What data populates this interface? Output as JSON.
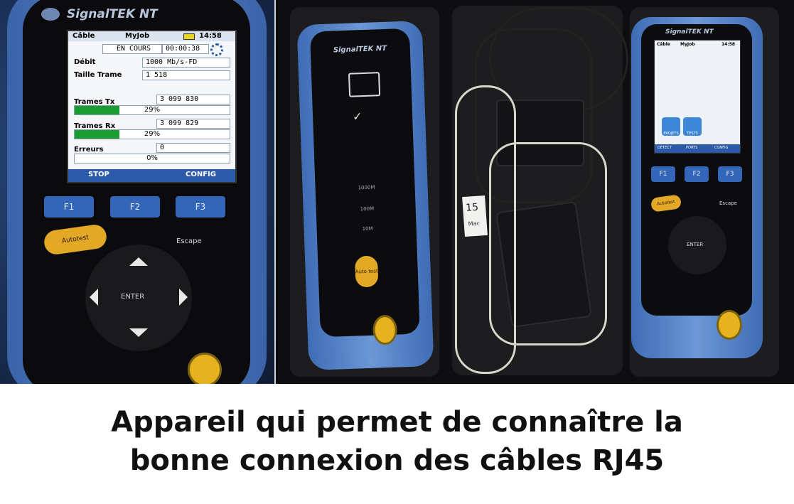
{
  "left_device": {
    "brand": "SignalTEK NT",
    "screen": {
      "header_left": "Câble",
      "header_job": "MyJob",
      "header_time": "14:58",
      "status": "EN COURS",
      "timer": "00:00:38",
      "debit_label": "Débit",
      "debit_value": "1000 Mb/s-FD",
      "taille_label": "Taille Trame",
      "taille_value": "1 518",
      "tx_label": "Trames Tx",
      "tx_value": "3 099 830",
      "tx_pct_label": "29%",
      "tx_pct": 0.29,
      "rx_label": "Trames Rx",
      "rx_value": "3 099 829",
      "rx_pct_label": "29%",
      "rx_pct": 0.29,
      "err_label": "Erreurs",
      "err_value": "0",
      "err_pct_label": "0%",
      "err_pct": 0,
      "softkey_left": "STOP",
      "softkey_right": "CONFIG"
    },
    "keys": {
      "f1": "F1",
      "f2": "F2",
      "f3": "F3",
      "autotest": "Autotest",
      "escape": "Escape",
      "enter": "ENTER"
    }
  },
  "right_photo": {
    "device1_brand": "SignalTEK NT",
    "device1_autotest": "Auto test",
    "device1_speeds": [
      "1000M",
      "100M",
      "10M"
    ],
    "device2_brand": "SignalTEK NT",
    "device2_screen_header": "Câble",
    "device2_screen_job": "MyJob",
    "device2_screen_time": "14:58",
    "device2_tabs": [
      "DETECT",
      "PORTS",
      "CONFIG"
    ],
    "device2_icons": [
      "PROJETS",
      "TESTS"
    ],
    "device2_keys": {
      "f1": "F1",
      "f2": "F2",
      "f3": "F3",
      "autotest": "Autotest",
      "escape": "Escape",
      "enter": "ENTER"
    },
    "tag_text": "15",
    "tag_small": "Mac"
  },
  "caption": {
    "line1": "Appareil qui permet de connaître la",
    "line2": "bonne connexion des câbles RJ45"
  },
  "colors": {
    "device_blue": "#4f7fc4",
    "progress_green": "#1c9b32",
    "softkey_bar": "#2b5aa8",
    "autotest_yellow": "#e3a826"
  }
}
